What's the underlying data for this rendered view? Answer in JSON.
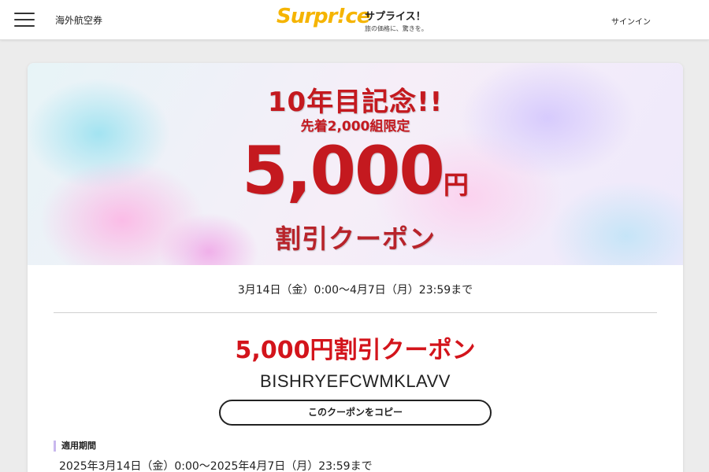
{
  "header": {
    "nav_link": "海外航空券",
    "logo": "Surpr!ce",
    "brand_name": "サプライス！",
    "brand_tagline": "旅の価格に、驚きを。",
    "signin": "サインイン"
  },
  "banner": {
    "anniversary": "10年目記念!!",
    "limit": "先着2,000組限定",
    "amount": "5,000",
    "unit": "円",
    "coupon_label": "割引クーポン"
  },
  "coupon": {
    "period": "3月14日（金）0:00〜4月7日（月）23:59まで",
    "title": "5,000円割引クーポン",
    "code": "BISHRYEFCWMKLAVV",
    "copy_button": "このクーポンをコピー",
    "validity_label": "適用期間",
    "validity_value": "2025年3月14日（金）0:00〜2025年4月7日（月）23:59まで"
  },
  "colors": {
    "accent_red": "#d3141b",
    "logo_yellow": "#f5b400",
    "label_bar": "#c9b8ee"
  },
  "icons": {
    "menu": "hamburger-menu-icon"
  }
}
